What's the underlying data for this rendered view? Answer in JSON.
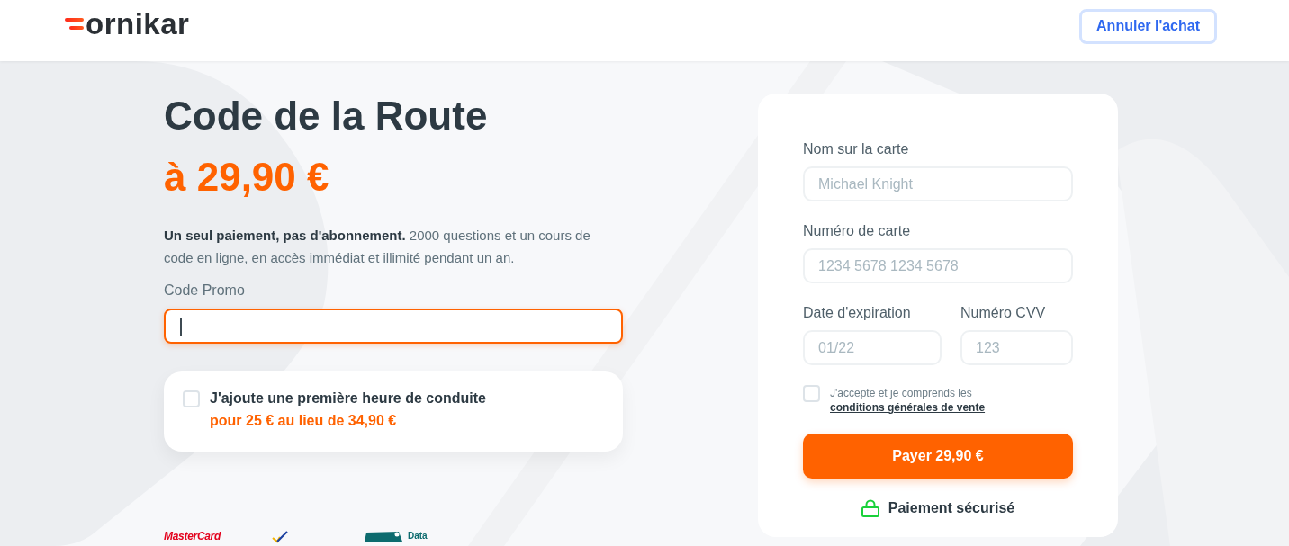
{
  "header": {
    "logo": "ornikar",
    "cancel_button": "Annuler l'achat"
  },
  "offer": {
    "title": "Code de la Route",
    "price": "à 29,90 €",
    "description": "**Un seul paiement, pas d'abonnement.** 2000 questions et un cours de code en ligne, en accès immédiat et illimité pendant un an.",
    "promo": {
      "label": "Code Promo",
      "focused": true
    },
    "addon": {
      "checked": false,
      "title": "J'ajoute une première heure de conduite",
      "price": "pour 25 € au lieu de 34,90 €"
    }
  },
  "payment_logos": [
    {
      "kind": "wordmark",
      "text": "MasterCard"
    },
    {
      "kind": "check"
    },
    {
      "kind": "tag",
      "text": "Data"
    }
  ],
  "payment_form": {
    "rows": [
      [
        {
          "label": "Nom sur la carte",
          "placeholder": "Michael Knight"
        }
      ],
      [
        {
          "label": "Numéro de carte",
          "placeholder": "1234 5678 1234 5678"
        }
      ],
      [
        {
          "label": "Date d'expiration",
          "placeholder": "01/22"
        },
        {
          "label": "Numéro CVV",
          "placeholder": "123"
        }
      ]
    ],
    "terms": {
      "checked": false,
      "text": "J'accepte et je comprends les",
      "link": "conditions générales de vente"
    },
    "pay_button": "Payer 29,90 €",
    "secure_note": "Paiement sécurisé"
  }
}
